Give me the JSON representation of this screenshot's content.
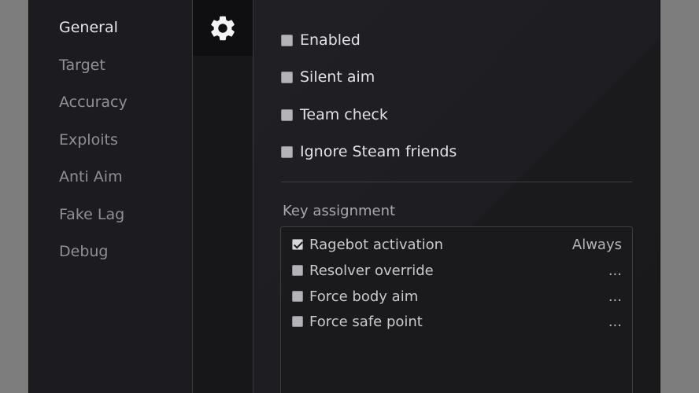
{
  "sidebar": {
    "items": [
      {
        "label": "General",
        "active": true
      },
      {
        "label": "Target",
        "active": false
      },
      {
        "label": "Accuracy",
        "active": false
      },
      {
        "label": "Exploits",
        "active": false
      },
      {
        "label": "Anti Aim",
        "active": false
      },
      {
        "label": "Fake Lag",
        "active": false
      },
      {
        "label": "Debug",
        "active": false
      }
    ]
  },
  "iconbar": {
    "active_icon": "gear-icon"
  },
  "general": {
    "options": [
      {
        "label": "Enabled",
        "checked": false
      },
      {
        "label": "Silent aim",
        "checked": false
      },
      {
        "label": "Team check",
        "checked": false
      },
      {
        "label": "Ignore Steam friends",
        "checked": false
      }
    ]
  },
  "key_assignment": {
    "title": "Key assignment",
    "rows": [
      {
        "label": "Ragebot activation",
        "checked": true,
        "value": "Always"
      },
      {
        "label": "Resolver override",
        "checked": false,
        "value": "..."
      },
      {
        "label": "Force body aim",
        "checked": false,
        "value": "..."
      },
      {
        "label": "Force safe point",
        "checked": false,
        "value": "..."
      }
    ]
  },
  "colors": {
    "background": "#7d7d7d",
    "window": "#1d1d21",
    "text_active": "#e6e6ea",
    "text_inactive": "#8f8f96",
    "checkbox": "#b4b4b8"
  }
}
